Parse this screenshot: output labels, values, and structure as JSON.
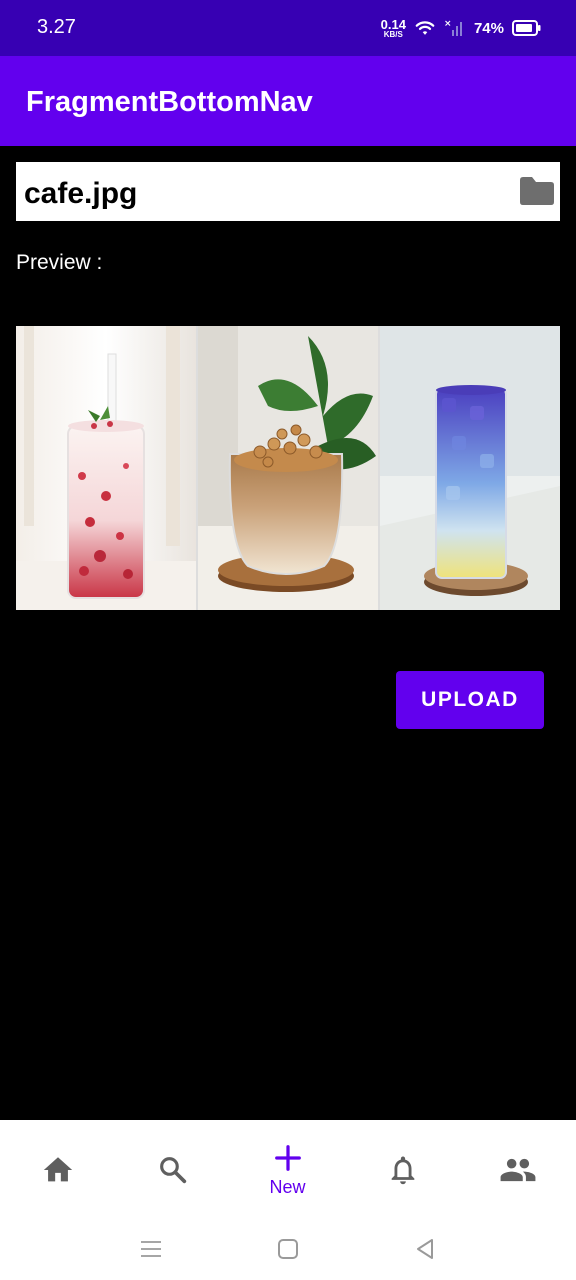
{
  "status_bar": {
    "time": "3.27",
    "net_speed": "0.14",
    "net_unit": "KB/S",
    "battery": "74%"
  },
  "app_bar": {
    "title": "FragmentBottomNav"
  },
  "file_picker": {
    "file_name": "cafe.jpg",
    "icon": "folder-icon"
  },
  "preview": {
    "label": "Preview :"
  },
  "upload_button": {
    "label": "UPLOAD"
  },
  "bottom_nav": {
    "items": [
      {
        "icon": "home-icon",
        "label": ""
      },
      {
        "icon": "search-icon",
        "label": ""
      },
      {
        "icon": "add-icon",
        "label": "New",
        "active": true
      },
      {
        "icon": "bell-icon",
        "label": ""
      },
      {
        "icon": "people-icon",
        "label": ""
      }
    ]
  },
  "colors": {
    "status_bar": "#3700B3",
    "primary": "#6200EE",
    "background": "#000000",
    "icon_gray": "#5f5f5f"
  }
}
